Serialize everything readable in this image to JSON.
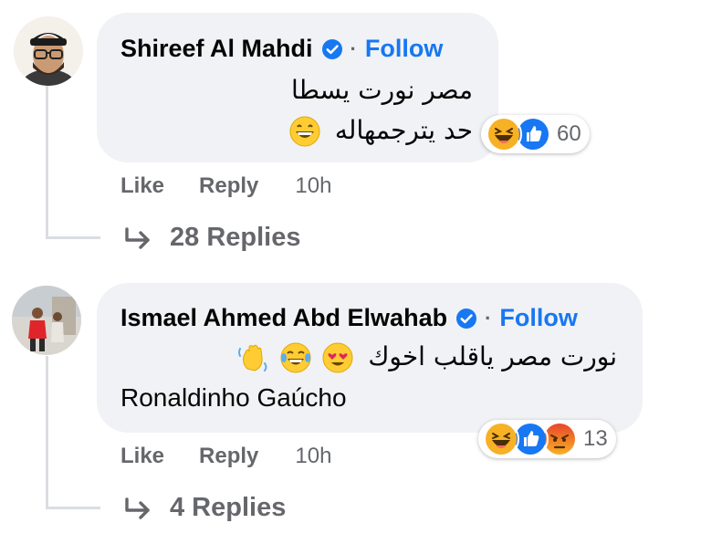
{
  "comments": [
    {
      "author": "Shireef Al Mahdi",
      "verified": true,
      "follow_label": "Follow",
      "separator": "·",
      "text_lines": [
        "مصر نورت يسطا",
        "حد يترجمهاله"
      ],
      "inline_emojis": [
        "grinning-face"
      ],
      "reactions": [
        "haha",
        "like"
      ],
      "reaction_count": "60",
      "actions": {
        "like": "Like",
        "reply": "Reply",
        "time": "10h"
      },
      "replies_label": "28 Replies"
    },
    {
      "author": "Ismael Ahmed Abd Elwahab",
      "verified": true,
      "follow_label": "Follow",
      "separator": "·",
      "text_lines": [
        "نورت مصر ياقلب اخوك",
        "Ronaldinho Gaúcho"
      ],
      "inline_emojis": [
        "waving-hand",
        "tears-of-joy",
        "heart-eyes"
      ],
      "reactions": [
        "haha",
        "like",
        "angry"
      ],
      "reaction_count": "13",
      "actions": {
        "like": "Like",
        "reply": "Reply",
        "time": "10h"
      },
      "replies_label": "4 Replies"
    }
  ],
  "colors": {
    "link": "#1877f2",
    "bubble": "#f0f2f5",
    "meta": "#65676b",
    "text": "#050505"
  }
}
